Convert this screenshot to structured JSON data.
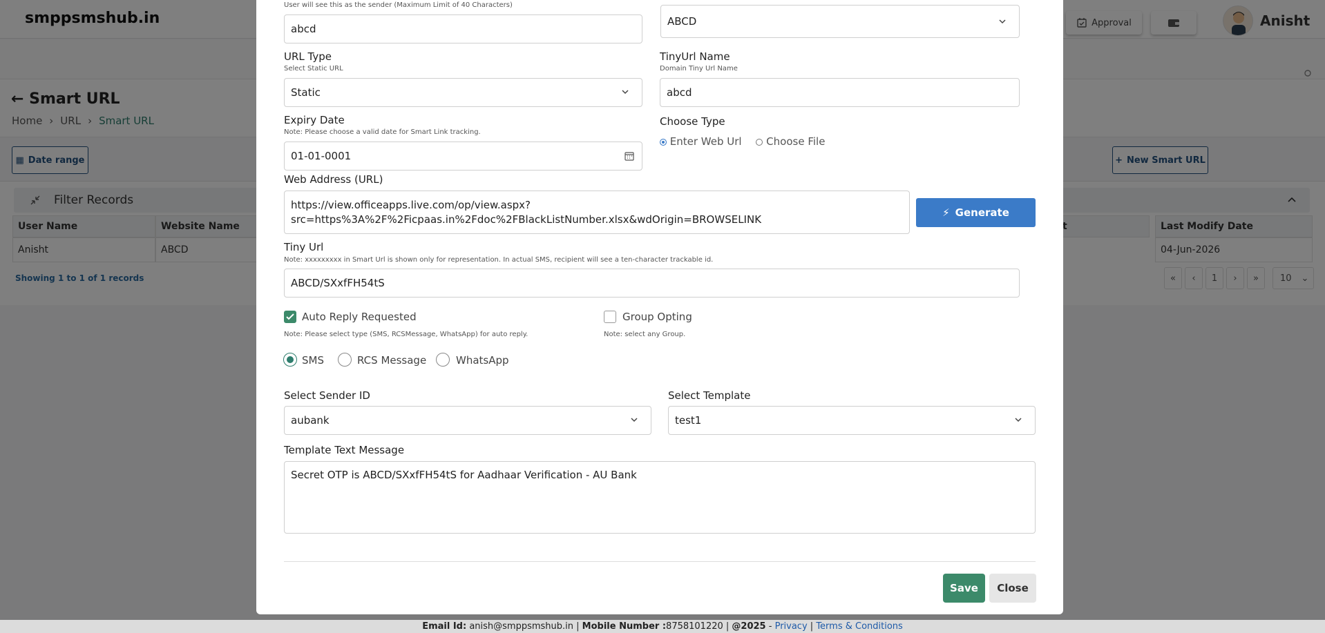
{
  "header": {
    "brand": "smppsmshub.in",
    "approval_label": "Approval",
    "user_name": "Anisht"
  },
  "page": {
    "title": "Smart URL",
    "breadcrumb": [
      "Home",
      "URL",
      "Smart URL"
    ],
    "date_range_label": "Date range",
    "new_button_label": "New Smart URL"
  },
  "filter": {
    "title": "Filter Records"
  },
  "table": {
    "columns": [
      "User Name",
      "Website Name",
      "t",
      "Last Modify Date"
    ],
    "row": {
      "user": "Anisht",
      "website": "ABCD",
      "modified": "04-Jun-2026"
    },
    "showing": "Showing 1 to 1 of 1 records",
    "pagination": [
      "«",
      "‹",
      "1",
      "›",
      "»"
    ],
    "page_size": "10"
  },
  "modal": {
    "sender_note": "User will see this as the sender (Maximum Limit of 40 Characters)",
    "sender_value": "abcd",
    "domain_value": "ABCD",
    "url_type_label": "URL Type",
    "url_type_note": "Select Static URL",
    "url_type_value": "Static",
    "tinyurl_name_label": "TinyUrl Name",
    "tinyurl_name_note": "Domain Tiny Url Name",
    "tinyurl_name_value": "abcd",
    "expiry_label": "Expiry Date",
    "expiry_note": "Note: Please choose a valid date for Smart Link tracking.",
    "expiry_value": "01-01-0001",
    "choose_type_label": "Choose Type",
    "choose_type_options": [
      "Enter Web Url",
      "Choose File"
    ],
    "web_address_label": "Web Address (URL)",
    "web_address_value_line1": "https://view.officeapps.live.com/op/view.aspx?",
    "web_address_value_line2": "src=https%3A%2F%2Ficpaas.in%2Fdoc%2FBlackListNumber.xlsx&wdOrigin=BROWSELINK",
    "generate_label": "Generate",
    "tiny_url_label": "Tiny Url",
    "tiny_url_note": "Note: xxxxxxxxx in Smart Url is shown only for representation. In actual SMS, recipient will see a ten-character trackable id.",
    "tiny_url_value": "ABCD/SXxfFH54tS",
    "auto_reply_label": "Auto Reply Requested",
    "auto_reply_note": "Note: Please select type (SMS, RCSMessage, WhatsApp) for auto reply.",
    "group_opting_label": "Group Opting",
    "group_opting_note": "Note: select any Group.",
    "channels": [
      "SMS",
      "RCS Message",
      "WhatsApp"
    ],
    "sender_id_label": "Select Sender ID",
    "sender_id_value": "aubank",
    "template_label": "Select Template",
    "template_value": "test1",
    "template_text_label": "Template Text Message",
    "template_text_value": "Secret OTP is ABCD/SXxfFH54tS for Aadhaar Verification - AU Bank",
    "save_label": "Save",
    "close_label": "Close"
  },
  "footer": {
    "email_label": "Email Id:",
    "email": "anish@smppsmshub.in",
    "mobile_label": "Mobile Number :",
    "mobile": "8758101220",
    "copyright": "@2025",
    "privacy": "Privacy",
    "terms": "Terms & Conditions"
  },
  "colors": {
    "primary": "#3b7bc8",
    "accent": "#2e7d6d",
    "save": "#3c8a6a",
    "nav": "#23517e"
  }
}
